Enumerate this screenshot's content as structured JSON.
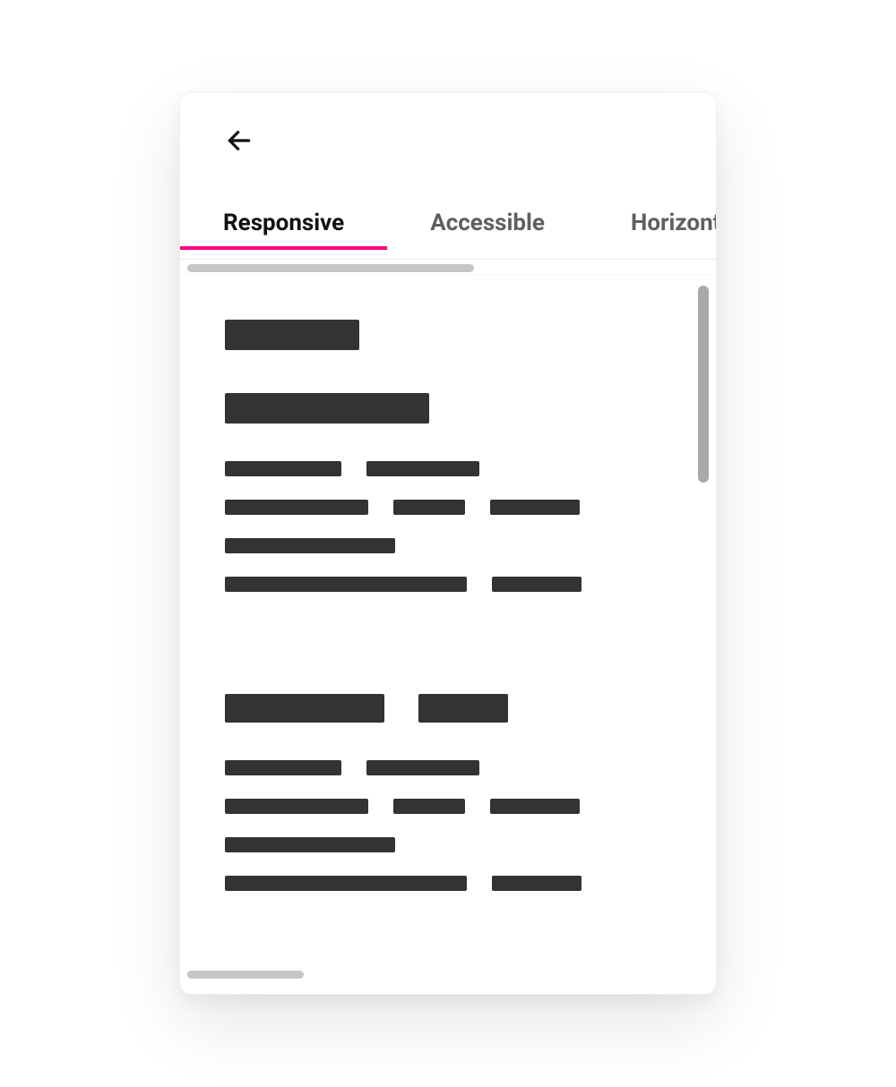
{
  "tabs": {
    "items": [
      {
        "label": "Responsive",
        "active": true
      },
      {
        "label": "Accessible",
        "active": false
      },
      {
        "label": "Horizontally Scrollable",
        "active": false
      }
    ]
  },
  "icons": {
    "back": "arrow-left-icon"
  },
  "colors": {
    "accent": "#ff0080",
    "skeleton": "#333333",
    "text_inactive": "#5f5f5f",
    "text_active": "#111111"
  }
}
